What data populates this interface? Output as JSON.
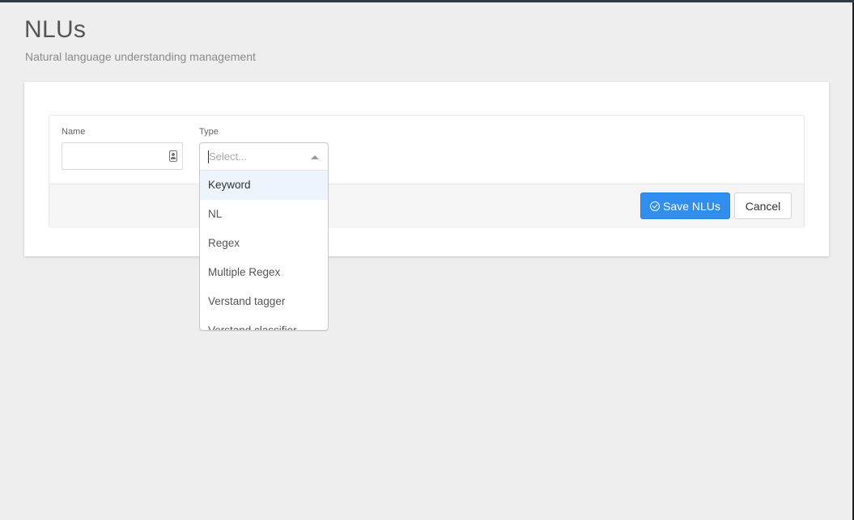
{
  "header": {
    "title": "NLUs",
    "subtitle": "Natural language understanding management"
  },
  "form": {
    "name_label": "Name",
    "name_value": "",
    "type_label": "Type",
    "type_placeholder": "Select...",
    "type_options": [
      "Keyword",
      "NL",
      "Regex",
      "Multiple Regex",
      "Verstand tagger",
      "Verstand classifier"
    ],
    "focused_option_index": 0
  },
  "actions": {
    "save_label": "Save NLUs",
    "cancel_label": "Cancel"
  },
  "colors": {
    "background": "#eeeeee",
    "primary": "#2f8ef0",
    "option_highlight": "#eef4fc"
  },
  "icons": {
    "name_input_icon": "contact-card-icon",
    "save_icon": "check-circle-icon",
    "select_arrow": "caret-up-icon"
  }
}
